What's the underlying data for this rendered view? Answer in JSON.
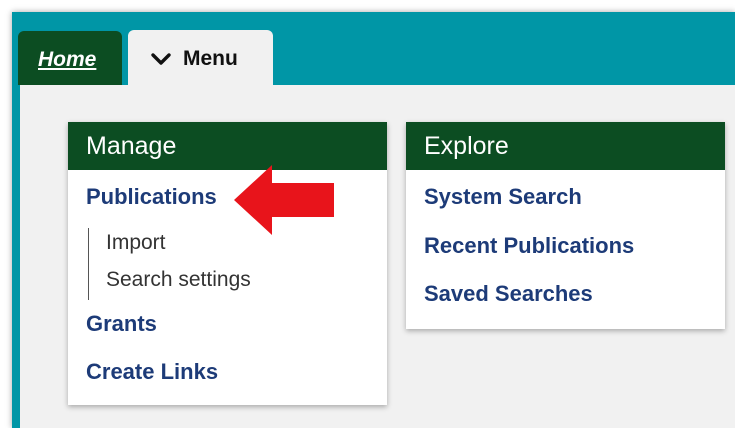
{
  "tabs": {
    "home_label": "Home",
    "menu_label": "Menu"
  },
  "manage": {
    "title": "Manage",
    "publications": "Publications",
    "import": "Import",
    "search_settings": "Search settings",
    "grants": "Grants",
    "create_links": "Create Links"
  },
  "explore": {
    "title": "Explore",
    "system_search": "System Search",
    "recent_publications": "Recent Publications",
    "saved_searches": "Saved Searches"
  },
  "colors": {
    "teal_frame": "#0096a6",
    "dark_green": "#0c4d22",
    "link_blue": "#1d3b78",
    "arrow_red": "#e8141b",
    "panel_gray": "#f1f1f1"
  },
  "icons": {
    "menu_chevron": "chevron-down-icon",
    "annotation": "red-arrow-icon"
  }
}
